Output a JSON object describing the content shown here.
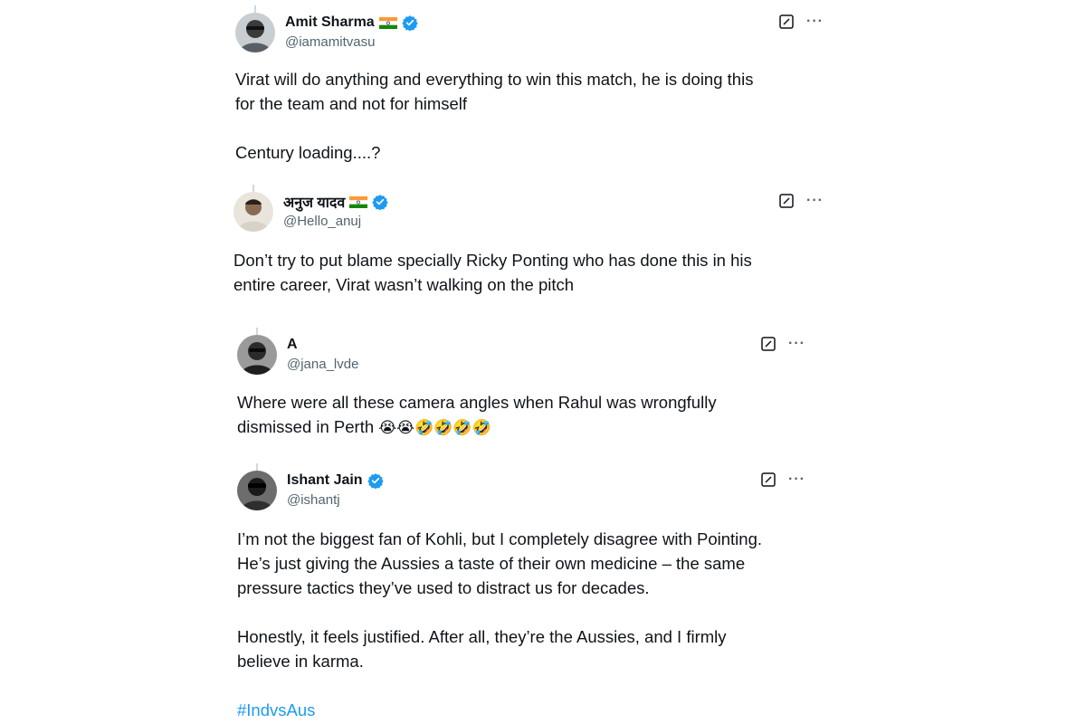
{
  "colors": {
    "text": "#0f1419",
    "secondary": "#536471",
    "verified": "#1d9bf0",
    "hashtag": "#1d9bf0"
  },
  "tweets": [
    {
      "author": "Amit Sharma",
      "handle": "@iamamitvasu",
      "verified": true,
      "flag": "india-flag-icon",
      "lines": [
        "Virat will do anything and everything to win this match, he is doing this",
        "for the team and not for himself"
      ],
      "lines2": [
        "Century loading....?"
      ]
    },
    {
      "author": "अनुज यादव",
      "handle": "@Hello_anuj",
      "verified": true,
      "flag": "india-flag-icon",
      "lines": [
        "Don’t try to put blame specially Ricky Ponting who has done this in his",
        "entire career, Virat wasn’t walking on the pitch"
      ]
    },
    {
      "author": "A",
      "handle": "@jana_lvde",
      "verified": false,
      "lines": [
        "Where were all these camera angles when Rahul was wrongfully",
        "dismissed in Perth"
      ],
      "emojis": "😭😭🤣🤣🤣🤣"
    },
    {
      "author": "Ishant Jain",
      "handle": "@ishantj",
      "verified": true,
      "lines": [
        "I’m not the biggest fan of Kohli, but I completely disagree with Pointing.",
        "He’s just giving the Aussies a taste of their own medicine – the same",
        "pressure tactics they’ve used to distract us for decades."
      ],
      "lines2": [
        "Honestly, it feels justified. After all, they’re the Aussies, and I firmly",
        "believe in karma."
      ],
      "hashtag": "#IndvsAus"
    }
  ],
  "icons": {
    "grok": "grok-icon",
    "more": "more-icon",
    "more_glyph": "···",
    "verified": "verified-badge-icon"
  }
}
